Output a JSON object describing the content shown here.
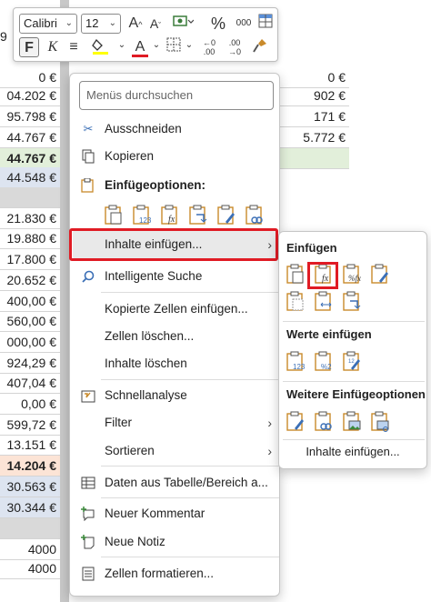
{
  "sheet": {
    "top_value": "9",
    "colA": [
      {
        "v": "0 €",
        "cls": ""
      },
      {
        "v": "04.202 €",
        "cls": ""
      },
      {
        "v": "95.798 €",
        "cls": ""
      },
      {
        "v": "44.767 €",
        "cls": ""
      },
      {
        "v": "44.767 €",
        "cls": "bold green"
      },
      {
        "v": "44.548 €",
        "cls": "blue"
      },
      {
        "v": "",
        "cls": "gray"
      },
      {
        "v": "21.830 €",
        "cls": ""
      },
      {
        "v": "19.880 €",
        "cls": ""
      },
      {
        "v": "17.800 €",
        "cls": ""
      },
      {
        "v": "20.652 €",
        "cls": ""
      },
      {
        "v": "400,00 €",
        "cls": ""
      },
      {
        "v": "560,00 €",
        "cls": ""
      },
      {
        "v": "000,00 €",
        "cls": ""
      },
      {
        "v": "924,29 €",
        "cls": ""
      },
      {
        "v": "407,04 €",
        "cls": ""
      },
      {
        "v": "0,00 €",
        "cls": ""
      },
      {
        "v": "599,72 €",
        "cls": ""
      },
      {
        "v": "13.151 €",
        "cls": ""
      },
      {
        "v": "14.204 €",
        "cls": "bold orange"
      },
      {
        "v": "30.563 €",
        "cls": "blue"
      },
      {
        "v": "30.344 €",
        "cls": "blue"
      },
      {
        "v": "",
        "cls": "gray"
      },
      {
        "v": "4000",
        "cls": ""
      },
      {
        "v": "4000",
        "cls": ""
      }
    ],
    "colC": [
      {
        "v": "0 €",
        "cls": ""
      },
      {
        "v": "0 €",
        "cls": ""
      },
      {
        "v": "902 €",
        "cls": ""
      },
      {
        "v": "171 €",
        "cls": ""
      },
      {
        "v": "5.772 €",
        "cls": ""
      },
      {
        "v": "",
        "cls": "green"
      }
    ]
  },
  "toolbar": {
    "font_name": "Calibri",
    "font_size": "12",
    "grow_font": "A^",
    "shrink_font": "Aˇ",
    "percent": "%",
    "thousands": "000",
    "bold": "F",
    "italic": "K",
    "align": "≡",
    "font_color_letter": "A",
    "dec_inc": "←.0",
    "dec_dec": ".00→",
    "fill_color": "#ffff00",
    "font_color": "#e01b24"
  },
  "menu": {
    "search_placeholder": "Menüs durchsuchen",
    "cut": "Ausschneiden",
    "copy": "Kopieren",
    "paste_options_header": "Einfügeoptionen:",
    "paste_special": "Inhalte einfügen...",
    "smart_lookup": "Intelligente Suche",
    "insert_copied": "Kopierte Zellen einfügen...",
    "delete_cells": "Zellen löschen...",
    "clear_contents": "Inhalte löschen",
    "quick_analysis": "Schnellanalyse",
    "filter": "Filter",
    "sort": "Sortieren",
    "table_data": "Daten aus Tabelle/Bereich a...",
    "new_comment": "Neuer Kommentar",
    "new_note": "Neue Notiz",
    "format_cells": "Zellen formatieren..."
  },
  "submenu": {
    "paste_header": "Einfügen",
    "values_header": "Werte einfügen",
    "more_header": "Weitere Einfügeoptionen",
    "paste_special_link": "Inhalte einfügen..."
  },
  "colors": {
    "highlight": "#e01b24",
    "icon_blue": "#3b6fb6",
    "clipboard_orange": "#c98a2b"
  }
}
